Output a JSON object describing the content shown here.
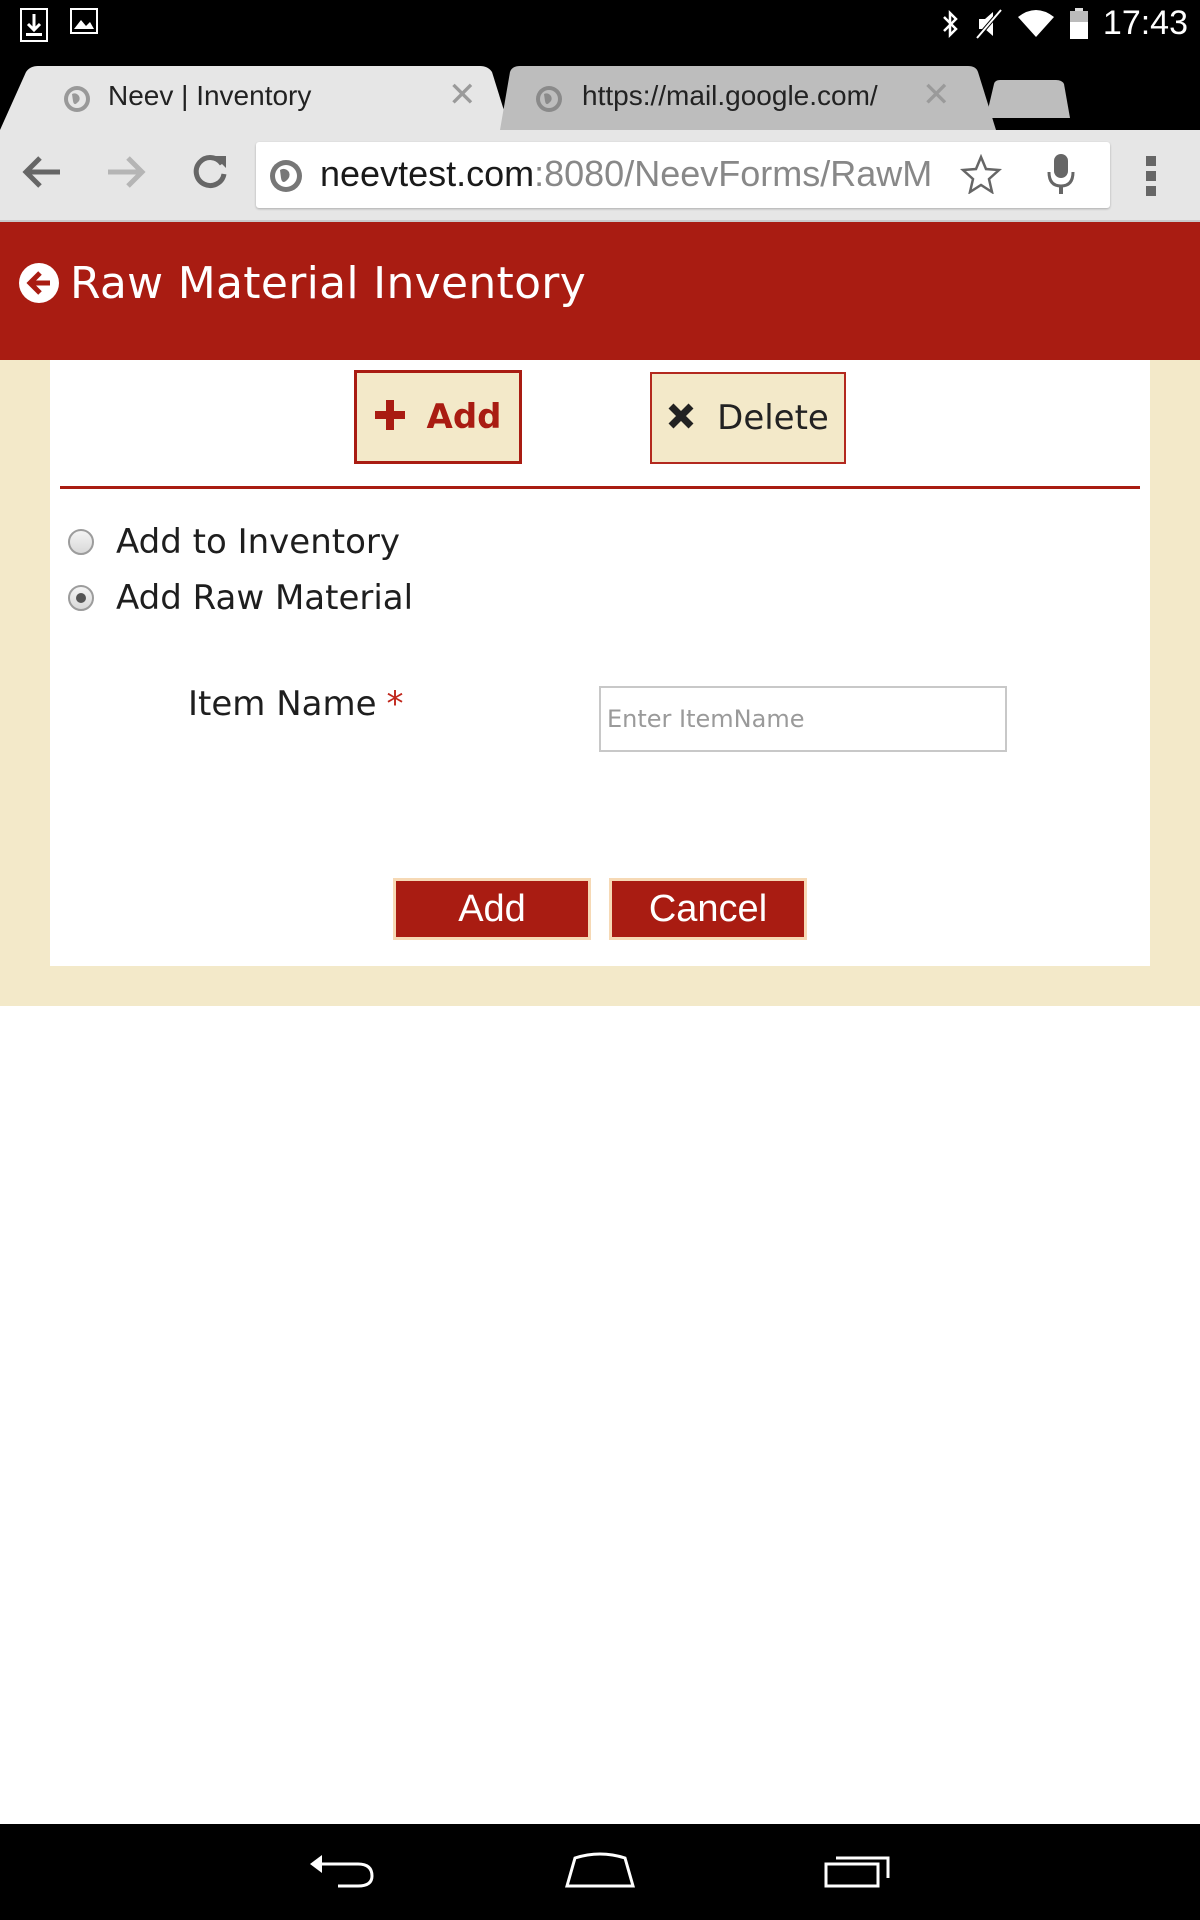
{
  "status_bar": {
    "time": "17:43",
    "icons": [
      "download-icon",
      "image-icon",
      "bluetooth-icon",
      "mute-icon",
      "wifi-icon",
      "battery-icon"
    ]
  },
  "browser": {
    "tabs": [
      {
        "title": "Neev | Inventory",
        "active": true
      },
      {
        "title": "https://mail.google.com/",
        "active": false
      }
    ],
    "url": {
      "host": "neevtest.com",
      "path": ":8080/NeevForms/RawM"
    }
  },
  "header": {
    "title": "Raw Material Inventory"
  },
  "actions": {
    "add_label": "Add",
    "delete_label": "Delete"
  },
  "options": [
    {
      "label": "Add to Inventory",
      "checked": false
    },
    {
      "label": "Add Raw Material",
      "checked": true
    }
  ],
  "form": {
    "item_name_label": "Item Name",
    "required_mark": "*",
    "item_name_placeholder": "Enter ItemName",
    "item_name_value": "",
    "add_button": "Add",
    "cancel_button": "Cancel"
  },
  "colors": {
    "brand_red": "#a91c12",
    "cream": "#f3e9c9"
  }
}
